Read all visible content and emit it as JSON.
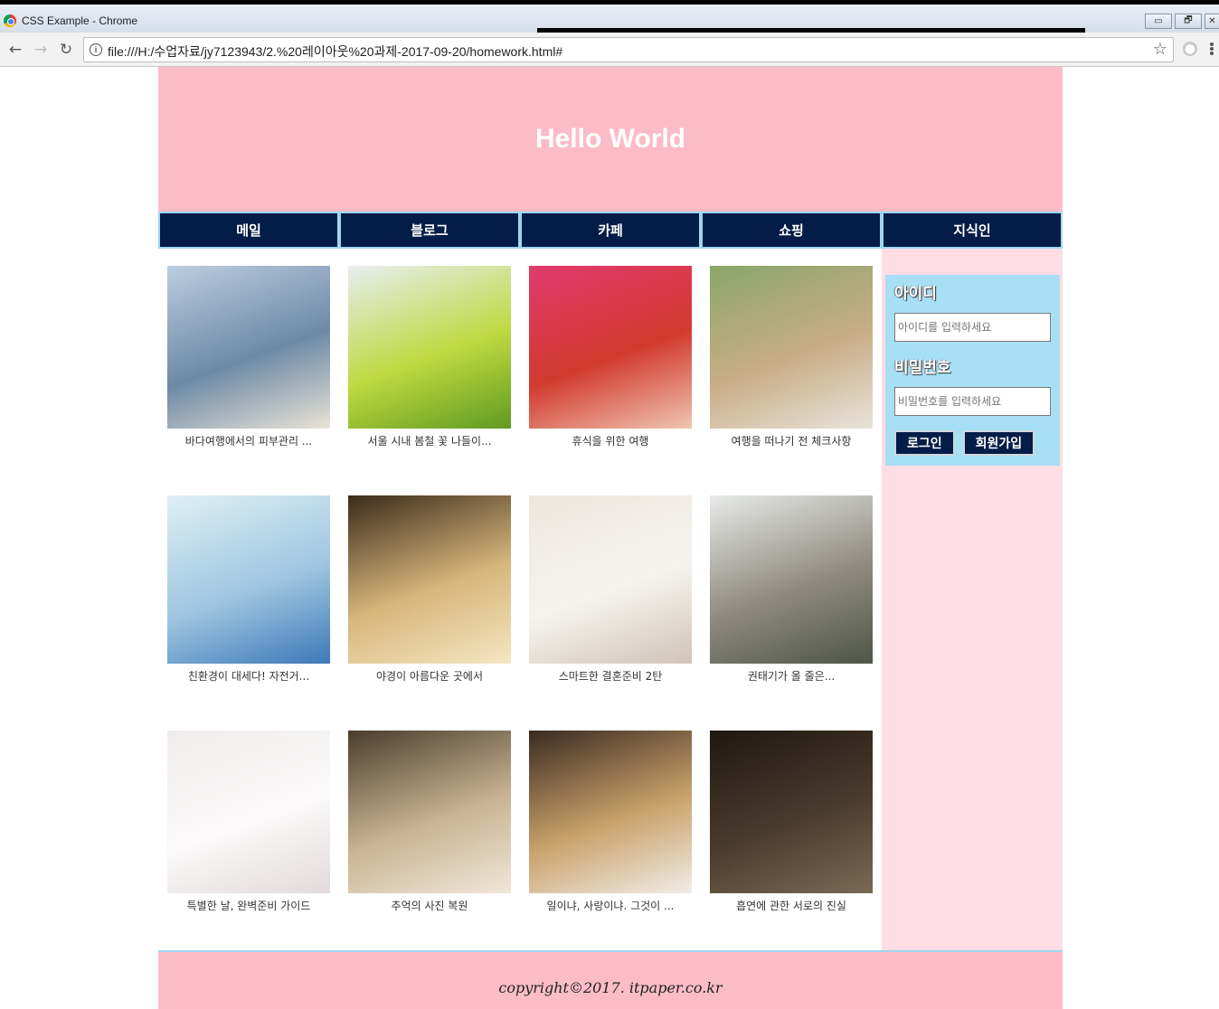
{
  "browser": {
    "window_title": "CSS Example - Chrome",
    "url": "file:///H:/수업자료/jy7123943/2.%20레이아웃%20과제-2017-09-20/homework.html#",
    "window_buttons": {
      "minimize": "▭",
      "restore": "🗗",
      "close": "✕"
    }
  },
  "header": {
    "title": "Hello World"
  },
  "nav": {
    "items": [
      {
        "label": "메일"
      },
      {
        "label": "블로그"
      },
      {
        "label": "카페"
      },
      {
        "label": "쇼핑"
      },
      {
        "label": "지식인"
      }
    ]
  },
  "gallery": {
    "items": [
      {
        "caption": "바다여행에서의 피부관리 ...",
        "colors": [
          "#bccde0",
          "#6d8aa6",
          "#e9e3d6"
        ]
      },
      {
        "caption": "서울 시내 봄철 꽃 나들이...",
        "colors": [
          "#e8eef0",
          "#bfd940",
          "#5f9b21"
        ]
      },
      {
        "caption": "휴식을 위한 여행",
        "colors": [
          "#e03a6e",
          "#d23a2e",
          "#f0c6b2"
        ]
      },
      {
        "caption": "여행을 떠나기 전 체크사항",
        "colors": [
          "#8aa66a",
          "#c9ad86",
          "#e8e4dc"
        ]
      },
      {
        "caption": "친환경이 대세다! 자전거...",
        "colors": [
          "#dff0f5",
          "#9fc6e0",
          "#3d78b8"
        ]
      },
      {
        "caption": "야경이 아름다운 곳에서",
        "colors": [
          "#3b2a1b",
          "#d6b77b",
          "#f5e6c2"
        ]
      },
      {
        "caption": "스마트한 결혼준비 2탄",
        "colors": [
          "#ece6de",
          "#f6f3ef",
          "#cfc4b6"
        ]
      },
      {
        "caption": "권태기가 올 줄은...",
        "colors": [
          "#e8ebe9",
          "#8f8a80",
          "#4e5547"
        ]
      },
      {
        "caption": "특별한 날, 완벽준비 가이드",
        "colors": [
          "#f0ecec",
          "#fbf9f9",
          "#e2dada"
        ]
      },
      {
        "caption": "추억의 사진 복원",
        "colors": [
          "#4a3d2c",
          "#c9b394",
          "#f0e7d8"
        ]
      },
      {
        "caption": "일이냐, 사랑이냐. 그것이 ...",
        "colors": [
          "#3a2a22",
          "#c9a26a",
          "#f1ede8"
        ]
      },
      {
        "caption": "흡연에 관한 서로의 진실",
        "colors": [
          "#1e1812",
          "#4a3b2d",
          "#7a6a55"
        ]
      }
    ]
  },
  "login": {
    "id_label": "아이디",
    "id_placeholder": "아이디를 입력하세요",
    "pw_label": "비밀번호",
    "pw_placeholder": "비밀번호를 입력하세요",
    "login_button": "로그인",
    "signup_button": "회원가입"
  },
  "footer": {
    "copyright": "copyright©2017. itpaper.co.kr"
  },
  "colors": {
    "header_bg": "#fbbcc8",
    "nav_bg": "#041c48",
    "nav_border": "#9fd6ef",
    "aside_bg": "#ffdde4",
    "login_box_bg": "#a7dff4"
  }
}
